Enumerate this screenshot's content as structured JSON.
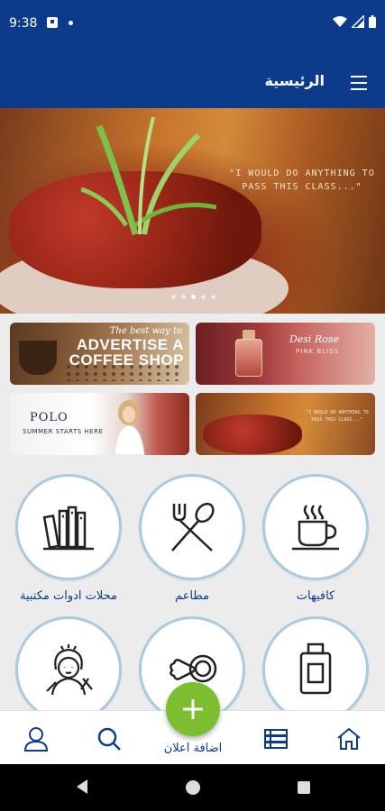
{
  "status_bar": {
    "time": "9:38"
  },
  "app_bar": {
    "title": "الرئيسية",
    "menu_icon": "hamburger-menu-icon"
  },
  "hero": {
    "quote": "\"I WOULD DO ANYTHING TO PASS THIS CLASS...\"",
    "slide_count": 5,
    "active_slide": 2
  },
  "ads": [
    {
      "name": "coffee",
      "line1": "The best way to",
      "line2": "ADVERTISE A COFFEE SHOP"
    },
    {
      "name": "perfume",
      "line1": "Desi Rose",
      "line2": "PINK BLISS"
    },
    {
      "name": "polo",
      "line1": "POLO",
      "line2": "SUMMER STARTS HERE"
    },
    {
      "name": "food",
      "line1": "\"I WOULD DO ANYTHING TO PASS THIS CLASS...\""
    }
  ],
  "categories": [
    {
      "label": "كافيهات",
      "icon": "coffee-cup-icon"
    },
    {
      "label": "مطاعم",
      "icon": "fork-spoon-icon"
    },
    {
      "label": "محلات ادوات مكتبية",
      "icon": "books-icon"
    },
    {
      "label": "",
      "icon": "perfume-bottle-icon"
    },
    {
      "label": "",
      "icon": "dog-bone-icon"
    },
    {
      "label": "",
      "icon": "hairdresser-icon"
    }
  ],
  "bottom_nav": {
    "add_label": "اضافة اعلان",
    "items": [
      "home-icon",
      "list-icon",
      "add-icon",
      "search-icon",
      "user-icon"
    ]
  },
  "colors": {
    "primary": "#0d3b8c",
    "fab": "#7cbe2f",
    "circle_border": "#a9cbdf"
  }
}
